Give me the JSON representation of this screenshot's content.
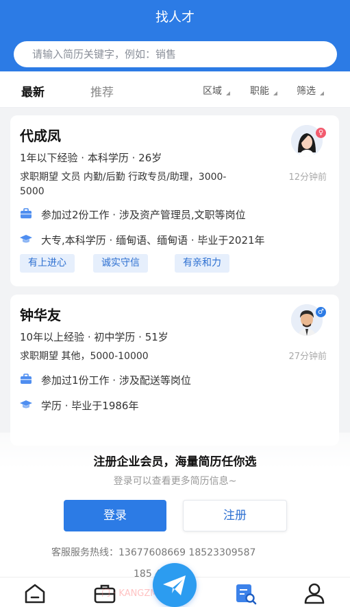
{
  "header": {
    "title": "找人才"
  },
  "search": {
    "placeholder": "请输入简历关键字，例如：销售"
  },
  "tabs": [
    {
      "label": "最新",
      "active": true
    },
    {
      "label": "推荐",
      "active": false
    }
  ],
  "filters": [
    {
      "label": "区域"
    },
    {
      "label": "职能"
    },
    {
      "label": "筛选"
    }
  ],
  "candidates": [
    {
      "name": "代成凤",
      "meta": "1年以下经验 · 本科学历 · 26岁",
      "expect": "求职期望 文员 内勤/后勤 行政专员/助理，3000-5000",
      "work": "参加过2份工作 · 涉及资产管理员,文职等岗位",
      "edu": "大专,本科学历 · 缅甸语、缅甸语 · 毕业于2021年",
      "time": "12分钟前",
      "gender_symbol": "♀",
      "gender_color": "#f25b6e",
      "tags": [
        "有上进心",
        "诚实守信",
        "有亲和力"
      ]
    },
    {
      "name": "钟华友",
      "meta": "10年以上经验 · 初中学历 · 51岁",
      "expect": "求职期望 其他，5000-10000",
      "work": "参加过1份工作 · 涉及配送等岗位",
      "edu": "学历 · 毕业于1986年",
      "time": "27分钟前",
      "gender_symbol": "♂",
      "gender_color": "#2c7be5",
      "tags": []
    }
  ],
  "promo": {
    "title": "注册企业会员，海量简历任你选",
    "subtitle": "登录可以查看更多简历信息~",
    "login_label": "登录",
    "register_label": "注册",
    "hotline": "客服服务热线：13677608669 18523309587",
    "hotline_partial": "185      479"
  },
  "watermark": "门 · KANGZM.COM",
  "nav": {
    "items": [
      {
        "icon": "home-icon"
      },
      {
        "icon": "briefcase-icon"
      },
      {
        "icon": "send-icon"
      },
      {
        "icon": "resume-search-icon"
      },
      {
        "icon": "user-icon"
      }
    ]
  },
  "colors": {
    "primary": "#2c7be5",
    "tag_bg": "#e6effc",
    "tag_text": "#2c6fd1"
  }
}
